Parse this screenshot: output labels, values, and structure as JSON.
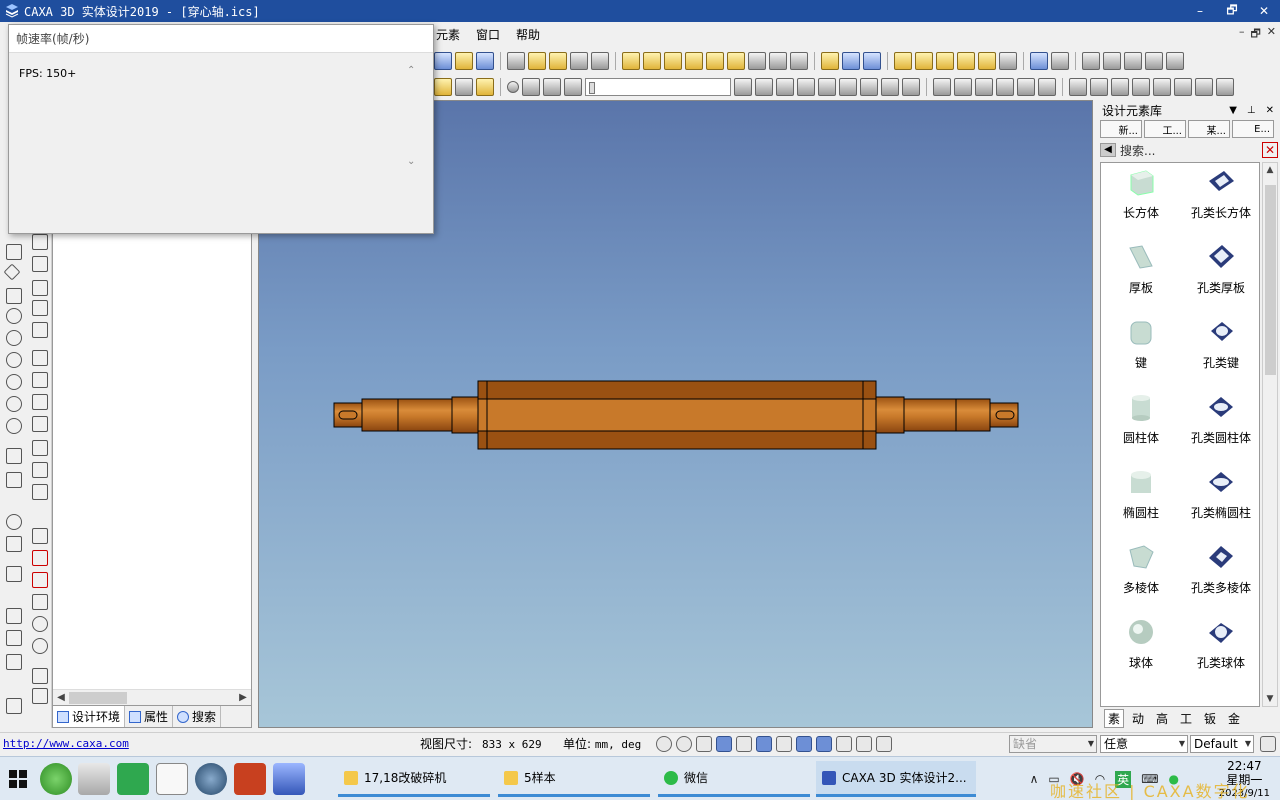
{
  "app": {
    "title": "CAXA 3D 实体设计2019 - [穿心轴.ics]",
    "window_buttons": [
      "–",
      "🗗",
      "✕"
    ]
  },
  "menu": {
    "items": [
      "元素",
      "窗口",
      "帮助"
    ],
    "right_buttons": [
      "–",
      "🗗",
      "✕"
    ]
  },
  "fps_dialog": {
    "title": "帧速率(帧/秒)",
    "value": "FPS: 150+"
  },
  "tree_panel": {
    "tabs": [
      {
        "label": "设计环境"
      },
      {
        "label": "属性"
      },
      {
        "label": "搜索"
      }
    ]
  },
  "library": {
    "title": "设计元素库",
    "tabs": [
      "新...",
      "工...",
      "某...",
      "E..."
    ],
    "search_placeholder": "搜索...",
    "items": [
      {
        "label": "长方体",
        "icon": "box-icon"
      },
      {
        "label": "孔类长方体",
        "icon": "hole-box-icon"
      },
      {
        "label": "厚板",
        "icon": "plate-icon"
      },
      {
        "label": "孔类厚板",
        "icon": "hole-plate-icon"
      },
      {
        "label": "键",
        "icon": "key-icon"
      },
      {
        "label": "孔类键",
        "icon": "hole-key-icon"
      },
      {
        "label": "圆柱体",
        "icon": "cylinder-icon"
      },
      {
        "label": "孔类圆柱体",
        "icon": "hole-cylinder-icon"
      },
      {
        "label": "椭圆柱",
        "icon": "ellipse-cylinder-icon"
      },
      {
        "label": "孔类椭圆柱",
        "icon": "hole-ellipse-cylinder-icon"
      },
      {
        "label": "多棱体",
        "icon": "prism-icon"
      },
      {
        "label": "孔类多棱体",
        "icon": "hole-prism-icon"
      },
      {
        "label": "球体",
        "icon": "sphere-icon"
      },
      {
        "label": "孔类球体",
        "icon": "hole-sphere-icon"
      }
    ],
    "bottom_tabs": [
      "素",
      "动",
      "高",
      "工",
      "钣",
      "金"
    ]
  },
  "status": {
    "link": "http://www.caxa.com",
    "view_size_label": "视图尺寸:",
    "view_size_value": "833 x  629",
    "unit_label": "单位:",
    "unit_value": "mm, deg",
    "combo1": "缺省",
    "combo2": "任意",
    "combo3": "Default"
  },
  "taskbar": {
    "tasks": [
      {
        "label": "17,18改破碎机"
      },
      {
        "label": "5样本"
      },
      {
        "label": "微信"
      },
      {
        "label": "CAXA 3D 实体设计2..."
      }
    ],
    "tray_ime": "英",
    "clock_time": "22:47",
    "clock_day": "星期一",
    "clock_date": "2023/9/11",
    "watermark": "咖速社区 | CAXA数字化"
  },
  "colors": {
    "title_bar": "#1f4e9e",
    "shaft_main": "#c8792a",
    "shaft_dark": "#9a5112",
    "viewport_top": "#5a75aa",
    "viewport_bottom": "#a7c6d8"
  }
}
